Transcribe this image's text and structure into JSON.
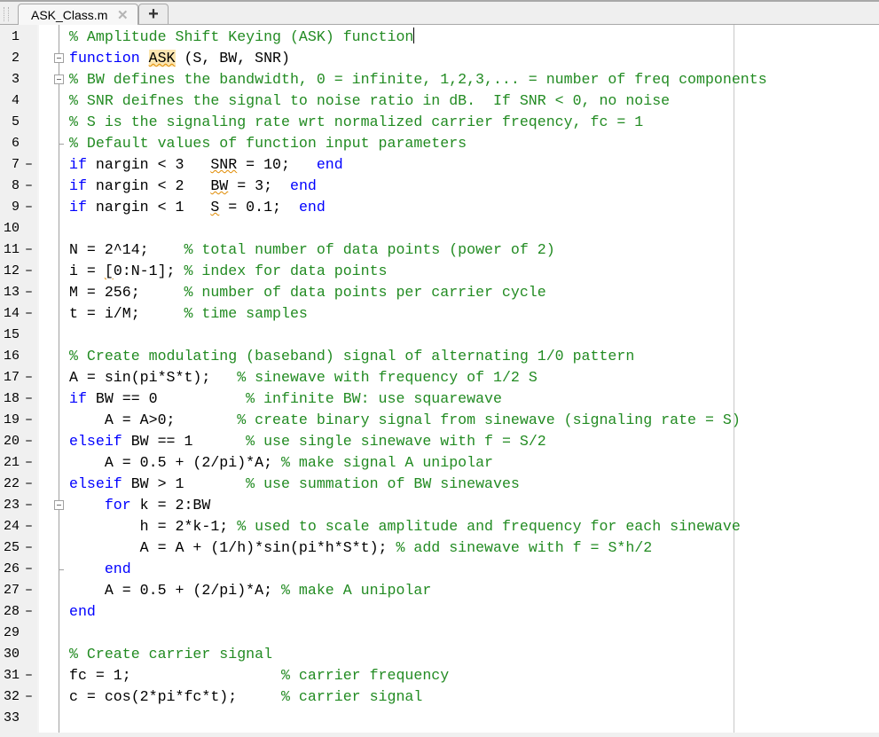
{
  "tabs": [
    {
      "label": "ASK_Class.m",
      "active": true,
      "close_icon": "close-icon"
    }
  ],
  "add_tab_label": "+",
  "colors": {
    "keyword": "#0000ff",
    "comment": "#228b22",
    "code": "#000000",
    "highlight": "#fce6b0"
  },
  "lines": [
    {
      "num": "1",
      "dash": "",
      "fold": "",
      "tokens": [
        {
          "t": "% Amplitude Shift Keying (ASK) function",
          "c": "com"
        }
      ],
      "caret": true
    },
    {
      "num": "2",
      "dash": "",
      "fold": "open",
      "tokens": [
        {
          "t": "function",
          "c": "kw"
        },
        {
          "t": " ",
          "c": "code"
        },
        {
          "t": "ASK",
          "c": "hl"
        },
        {
          "t": " (S, BW, SNR)",
          "c": "code"
        }
      ]
    },
    {
      "num": "3",
      "dash": "",
      "fold": "open",
      "tokens": [
        {
          "t": "% BW defines the bandwidth, 0 = infinite, 1,2,3,... = number of freq components",
          "c": "com"
        }
      ]
    },
    {
      "num": "4",
      "dash": "",
      "fold": "",
      "tokens": [
        {
          "t": "% SNR deifnes the signal to noise ratio in dB.  If SNR < 0, no noise",
          "c": "com"
        }
      ]
    },
    {
      "num": "5",
      "dash": "",
      "fold": "",
      "tokens": [
        {
          "t": "% S is the signaling rate wrt normalized carrier freqency, fc = 1",
          "c": "com"
        }
      ]
    },
    {
      "num": "6",
      "dash": "",
      "fold": "end",
      "tokens": [
        {
          "t": "% Default values of function input parameters",
          "c": "com"
        }
      ]
    },
    {
      "num": "7",
      "dash": "–",
      "fold": "",
      "tokens": [
        {
          "t": "if",
          "c": "kw"
        },
        {
          "t": " nargin < 3   ",
          "c": "code"
        },
        {
          "t": "SNR",
          "c": "warn"
        },
        {
          "t": " = 10;   ",
          "c": "code"
        },
        {
          "t": "end",
          "c": "kw"
        }
      ]
    },
    {
      "num": "8",
      "dash": "–",
      "fold": "",
      "tokens": [
        {
          "t": "if",
          "c": "kw"
        },
        {
          "t": " nargin < 2   ",
          "c": "code"
        },
        {
          "t": "BW",
          "c": "warn"
        },
        {
          "t": " = 3;  ",
          "c": "code"
        },
        {
          "t": "end",
          "c": "kw"
        }
      ]
    },
    {
      "num": "9",
      "dash": "–",
      "fold": "",
      "tokens": [
        {
          "t": "if",
          "c": "kw"
        },
        {
          "t": " nargin < 1   ",
          "c": "code"
        },
        {
          "t": "S",
          "c": "warn"
        },
        {
          "t": " = 0.1;  ",
          "c": "code"
        },
        {
          "t": "end",
          "c": "kw"
        }
      ]
    },
    {
      "num": "10",
      "dash": "",
      "fold": "",
      "tokens": []
    },
    {
      "num": "11",
      "dash": "–",
      "fold": "",
      "tokens": [
        {
          "t": "N = 2^14;    ",
          "c": "code"
        },
        {
          "t": "% total number of data points (power of 2)",
          "c": "com"
        }
      ]
    },
    {
      "num": "12",
      "dash": "–",
      "fold": "",
      "tokens": [
        {
          "t": "i = ",
          "c": "code"
        },
        {
          "t": "[",
          "c": "warn"
        },
        {
          "t": "0:N-1]; ",
          "c": "code"
        },
        {
          "t": "% index for data points",
          "c": "com"
        }
      ]
    },
    {
      "num": "13",
      "dash": "–",
      "fold": "",
      "tokens": [
        {
          "t": "M = 256;     ",
          "c": "code"
        },
        {
          "t": "% number of data points per carrier cycle",
          "c": "com"
        }
      ]
    },
    {
      "num": "14",
      "dash": "–",
      "fold": "",
      "tokens": [
        {
          "t": "t = i/M;     ",
          "c": "code"
        },
        {
          "t": "% time samples",
          "c": "com"
        }
      ]
    },
    {
      "num": "15",
      "dash": "",
      "fold": "",
      "tokens": []
    },
    {
      "num": "16",
      "dash": "",
      "fold": "",
      "tokens": [
        {
          "t": "% Create modulating (baseband) signal of alternating 1/0 pattern",
          "c": "com"
        }
      ]
    },
    {
      "num": "17",
      "dash": "–",
      "fold": "",
      "tokens": [
        {
          "t": "A = sin(pi*S*t);   ",
          "c": "code"
        },
        {
          "t": "% sinewave with frequency of 1/2 S",
          "c": "com"
        }
      ]
    },
    {
      "num": "18",
      "dash": "–",
      "fold": "",
      "tokens": [
        {
          "t": "if",
          "c": "kw"
        },
        {
          "t": " BW == 0          ",
          "c": "code"
        },
        {
          "t": "% infinite BW: use squarewave",
          "c": "com"
        }
      ]
    },
    {
      "num": "19",
      "dash": "–",
      "fold": "",
      "tokens": [
        {
          "t": "    A = A>0;       ",
          "c": "code"
        },
        {
          "t": "% create binary signal from sinewave (signaling rate = S)",
          "c": "com"
        }
      ]
    },
    {
      "num": "20",
      "dash": "–",
      "fold": "",
      "tokens": [
        {
          "t": "elseif",
          "c": "kw"
        },
        {
          "t": " BW == 1      ",
          "c": "code"
        },
        {
          "t": "% use single sinewave with f = S/2",
          "c": "com"
        }
      ]
    },
    {
      "num": "21",
      "dash": "–",
      "fold": "",
      "tokens": [
        {
          "t": "    A = 0.5 + (2/pi)*A; ",
          "c": "code"
        },
        {
          "t": "% make signal A unipolar",
          "c": "com"
        }
      ]
    },
    {
      "num": "22",
      "dash": "–",
      "fold": "",
      "tokens": [
        {
          "t": "elseif",
          "c": "kw"
        },
        {
          "t": " BW > 1       ",
          "c": "code"
        },
        {
          "t": "% use summation of BW sinewaves",
          "c": "com"
        }
      ]
    },
    {
      "num": "23",
      "dash": "–",
      "fold": "open",
      "tokens": [
        {
          "t": "    ",
          "c": "code"
        },
        {
          "t": "for",
          "c": "kw"
        },
        {
          "t": " k = 2:BW",
          "c": "code"
        }
      ]
    },
    {
      "num": "24",
      "dash": "–",
      "fold": "",
      "tokens": [
        {
          "t": "        h = 2*k-1; ",
          "c": "code"
        },
        {
          "t": "% used to scale amplitude and frequency for each sinewave",
          "c": "com"
        }
      ]
    },
    {
      "num": "25",
      "dash": "–",
      "fold": "",
      "tokens": [
        {
          "t": "        A = A + (1/h)*sin(pi*h*S*t); ",
          "c": "code"
        },
        {
          "t": "% add sinewave with f = S*h/2",
          "c": "com"
        }
      ]
    },
    {
      "num": "26",
      "dash": "–",
      "fold": "end",
      "tokens": [
        {
          "t": "    ",
          "c": "code"
        },
        {
          "t": "end",
          "c": "kw"
        }
      ]
    },
    {
      "num": "27",
      "dash": "–",
      "fold": "",
      "tokens": [
        {
          "t": "    A = 0.5 + (2/pi)*A; ",
          "c": "code"
        },
        {
          "t": "% make A unipolar",
          "c": "com"
        }
      ]
    },
    {
      "num": "28",
      "dash": "–",
      "fold": "",
      "tokens": [
        {
          "t": "end",
          "c": "kw"
        }
      ]
    },
    {
      "num": "29",
      "dash": "",
      "fold": "",
      "tokens": []
    },
    {
      "num": "30",
      "dash": "",
      "fold": "",
      "tokens": [
        {
          "t": "% Create carrier signal",
          "c": "com"
        }
      ]
    },
    {
      "num": "31",
      "dash": "–",
      "fold": "",
      "tokens": [
        {
          "t": "fc = 1;                 ",
          "c": "code"
        },
        {
          "t": "% carrier frequency",
          "c": "com"
        }
      ]
    },
    {
      "num": "32",
      "dash": "–",
      "fold": "",
      "tokens": [
        {
          "t": "c = cos(2*pi*fc*t);     ",
          "c": "code"
        },
        {
          "t": "% carrier signal",
          "c": "com"
        }
      ]
    },
    {
      "num": "33",
      "dash": "",
      "fold": "",
      "tokens": []
    }
  ]
}
